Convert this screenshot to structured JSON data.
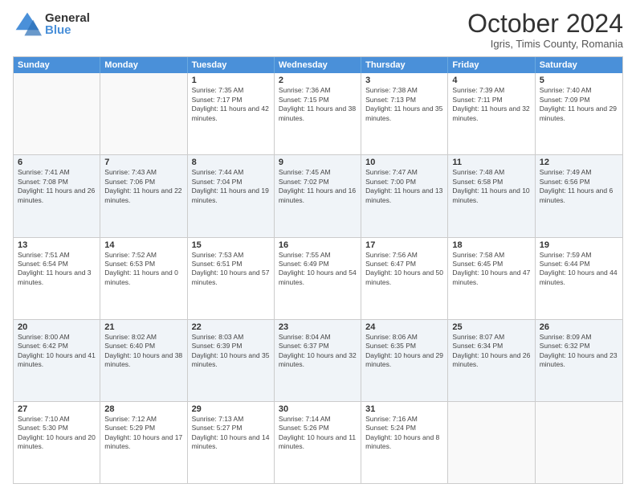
{
  "logo": {
    "general": "General",
    "blue": "Blue"
  },
  "header": {
    "month": "October 2024",
    "location": "Igris, Timis County, Romania"
  },
  "days_of_week": [
    "Sunday",
    "Monday",
    "Tuesday",
    "Wednesday",
    "Thursday",
    "Friday",
    "Saturday"
  ],
  "weeks": [
    [
      {
        "day": "",
        "empty": true
      },
      {
        "day": "",
        "empty": true
      },
      {
        "day": "1",
        "sunrise": "Sunrise: 7:35 AM",
        "sunset": "Sunset: 7:17 PM",
        "daylight": "Daylight: 11 hours and 42 minutes."
      },
      {
        "day": "2",
        "sunrise": "Sunrise: 7:36 AM",
        "sunset": "Sunset: 7:15 PM",
        "daylight": "Daylight: 11 hours and 38 minutes."
      },
      {
        "day": "3",
        "sunrise": "Sunrise: 7:38 AM",
        "sunset": "Sunset: 7:13 PM",
        "daylight": "Daylight: 11 hours and 35 minutes."
      },
      {
        "day": "4",
        "sunrise": "Sunrise: 7:39 AM",
        "sunset": "Sunset: 7:11 PM",
        "daylight": "Daylight: 11 hours and 32 minutes."
      },
      {
        "day": "5",
        "sunrise": "Sunrise: 7:40 AM",
        "sunset": "Sunset: 7:09 PM",
        "daylight": "Daylight: 11 hours and 29 minutes."
      }
    ],
    [
      {
        "day": "6",
        "sunrise": "Sunrise: 7:41 AM",
        "sunset": "Sunset: 7:08 PM",
        "daylight": "Daylight: 11 hours and 26 minutes."
      },
      {
        "day": "7",
        "sunrise": "Sunrise: 7:43 AM",
        "sunset": "Sunset: 7:06 PM",
        "daylight": "Daylight: 11 hours and 22 minutes."
      },
      {
        "day": "8",
        "sunrise": "Sunrise: 7:44 AM",
        "sunset": "Sunset: 7:04 PM",
        "daylight": "Daylight: 11 hours and 19 minutes."
      },
      {
        "day": "9",
        "sunrise": "Sunrise: 7:45 AM",
        "sunset": "Sunset: 7:02 PM",
        "daylight": "Daylight: 11 hours and 16 minutes."
      },
      {
        "day": "10",
        "sunrise": "Sunrise: 7:47 AM",
        "sunset": "Sunset: 7:00 PM",
        "daylight": "Daylight: 11 hours and 13 minutes."
      },
      {
        "day": "11",
        "sunrise": "Sunrise: 7:48 AM",
        "sunset": "Sunset: 6:58 PM",
        "daylight": "Daylight: 11 hours and 10 minutes."
      },
      {
        "day": "12",
        "sunrise": "Sunrise: 7:49 AM",
        "sunset": "Sunset: 6:56 PM",
        "daylight": "Daylight: 11 hours and 6 minutes."
      }
    ],
    [
      {
        "day": "13",
        "sunrise": "Sunrise: 7:51 AM",
        "sunset": "Sunset: 6:54 PM",
        "daylight": "Daylight: 11 hours and 3 minutes."
      },
      {
        "day": "14",
        "sunrise": "Sunrise: 7:52 AM",
        "sunset": "Sunset: 6:53 PM",
        "daylight": "Daylight: 11 hours and 0 minutes."
      },
      {
        "day": "15",
        "sunrise": "Sunrise: 7:53 AM",
        "sunset": "Sunset: 6:51 PM",
        "daylight": "Daylight: 10 hours and 57 minutes."
      },
      {
        "day": "16",
        "sunrise": "Sunrise: 7:55 AM",
        "sunset": "Sunset: 6:49 PM",
        "daylight": "Daylight: 10 hours and 54 minutes."
      },
      {
        "day": "17",
        "sunrise": "Sunrise: 7:56 AM",
        "sunset": "Sunset: 6:47 PM",
        "daylight": "Daylight: 10 hours and 50 minutes."
      },
      {
        "day": "18",
        "sunrise": "Sunrise: 7:58 AM",
        "sunset": "Sunset: 6:45 PM",
        "daylight": "Daylight: 10 hours and 47 minutes."
      },
      {
        "day": "19",
        "sunrise": "Sunrise: 7:59 AM",
        "sunset": "Sunset: 6:44 PM",
        "daylight": "Daylight: 10 hours and 44 minutes."
      }
    ],
    [
      {
        "day": "20",
        "sunrise": "Sunrise: 8:00 AM",
        "sunset": "Sunset: 6:42 PM",
        "daylight": "Daylight: 10 hours and 41 minutes."
      },
      {
        "day": "21",
        "sunrise": "Sunrise: 8:02 AM",
        "sunset": "Sunset: 6:40 PM",
        "daylight": "Daylight: 10 hours and 38 minutes."
      },
      {
        "day": "22",
        "sunrise": "Sunrise: 8:03 AM",
        "sunset": "Sunset: 6:39 PM",
        "daylight": "Daylight: 10 hours and 35 minutes."
      },
      {
        "day": "23",
        "sunrise": "Sunrise: 8:04 AM",
        "sunset": "Sunset: 6:37 PM",
        "daylight": "Daylight: 10 hours and 32 minutes."
      },
      {
        "day": "24",
        "sunrise": "Sunrise: 8:06 AM",
        "sunset": "Sunset: 6:35 PM",
        "daylight": "Daylight: 10 hours and 29 minutes."
      },
      {
        "day": "25",
        "sunrise": "Sunrise: 8:07 AM",
        "sunset": "Sunset: 6:34 PM",
        "daylight": "Daylight: 10 hours and 26 minutes."
      },
      {
        "day": "26",
        "sunrise": "Sunrise: 8:09 AM",
        "sunset": "Sunset: 6:32 PM",
        "daylight": "Daylight: 10 hours and 23 minutes."
      }
    ],
    [
      {
        "day": "27",
        "sunrise": "Sunrise: 7:10 AM",
        "sunset": "Sunset: 5:30 PM",
        "daylight": "Daylight: 10 hours and 20 minutes."
      },
      {
        "day": "28",
        "sunrise": "Sunrise: 7:12 AM",
        "sunset": "Sunset: 5:29 PM",
        "daylight": "Daylight: 10 hours and 17 minutes."
      },
      {
        "day": "29",
        "sunrise": "Sunrise: 7:13 AM",
        "sunset": "Sunset: 5:27 PM",
        "daylight": "Daylight: 10 hours and 14 minutes."
      },
      {
        "day": "30",
        "sunrise": "Sunrise: 7:14 AM",
        "sunset": "Sunset: 5:26 PM",
        "daylight": "Daylight: 10 hours and 11 minutes."
      },
      {
        "day": "31",
        "sunrise": "Sunrise: 7:16 AM",
        "sunset": "Sunset: 5:24 PM",
        "daylight": "Daylight: 10 hours and 8 minutes."
      },
      {
        "day": "",
        "empty": true
      },
      {
        "day": "",
        "empty": true
      }
    ]
  ]
}
